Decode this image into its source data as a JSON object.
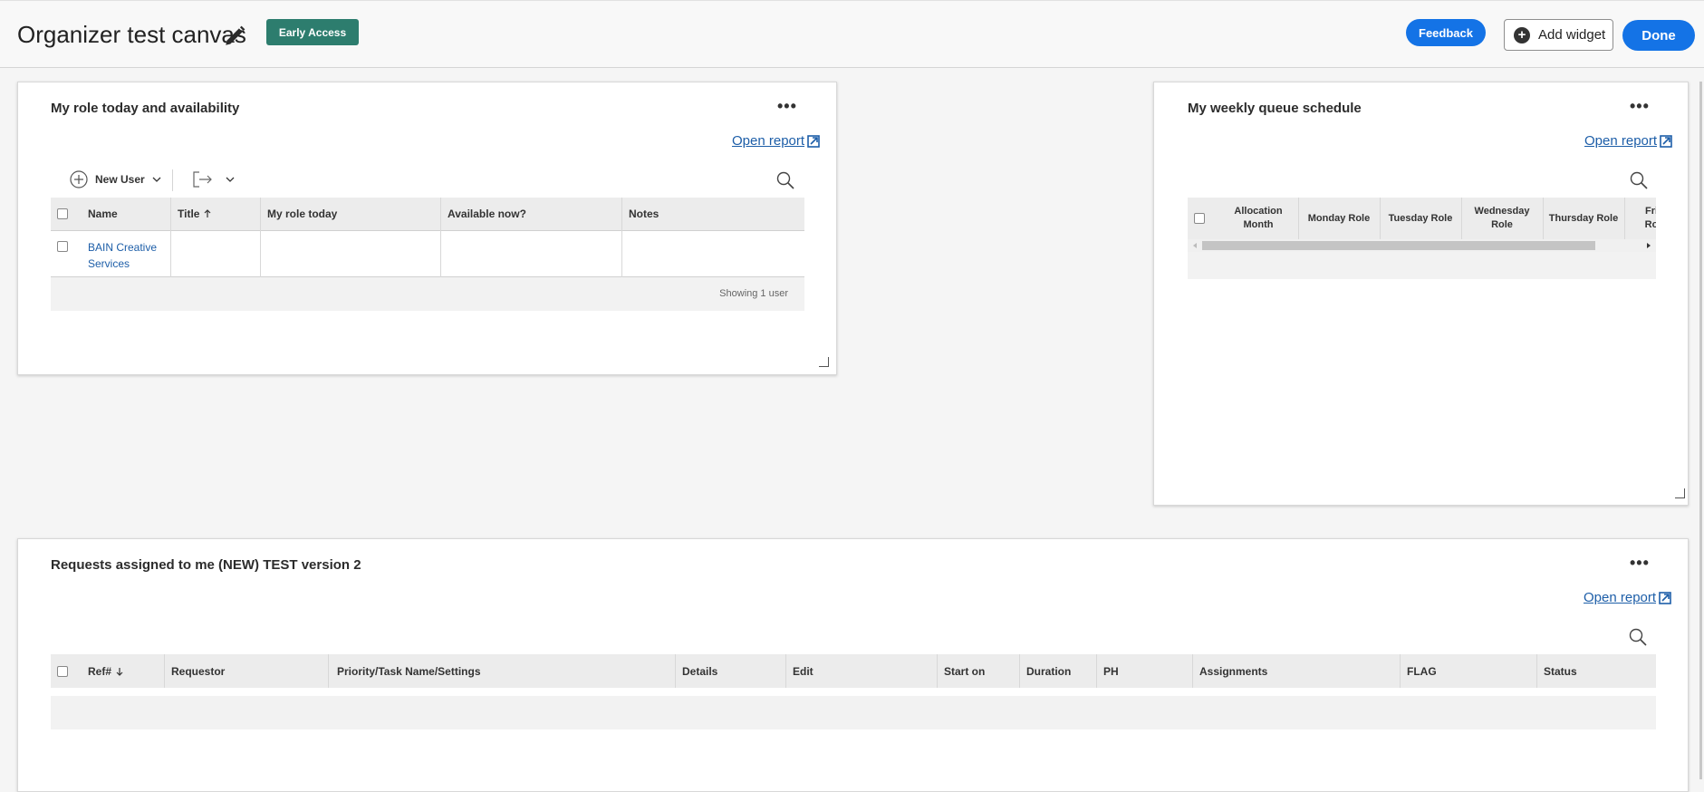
{
  "header": {
    "title": "Organizer test canvas",
    "badge": "Early Access",
    "feedback_label": "Feedback",
    "add_widget_label": "Add widget",
    "done_label": "Done"
  },
  "widget_role": {
    "title": "My role today and availability",
    "open_report": "Open report",
    "new_user_label": "New User",
    "columns": [
      "Name",
      "Title",
      "My role today",
      "Available now?",
      "Notes"
    ],
    "rows": [
      {
        "name_line1": "BAIN Creative",
        "name_line2": "Services",
        "title": "",
        "role": "",
        "available": "",
        "notes": ""
      }
    ],
    "footer": "Showing 1 user"
  },
  "widget_queue": {
    "title": "My weekly queue schedule",
    "open_report": "Open report",
    "columns": [
      {
        "l1": "Allocation",
        "l2": "Month"
      },
      {
        "l1": "Monday Role",
        "l2": ""
      },
      {
        "l1": "Tuesday Role",
        "l2": ""
      },
      {
        "l1": "Wednesday",
        "l2": "Role"
      },
      {
        "l1": "Thursday Role",
        "l2": ""
      },
      {
        "l1": "Fri",
        "l2": "Ro"
      }
    ]
  },
  "widget_requests": {
    "title": "Requests assigned to me (NEW) TEST version 2",
    "open_report": "Open report",
    "columns": [
      "Ref#",
      "Requestor",
      "Priority/Task Name/Settings",
      "Details",
      "Edit",
      "Start on",
      "Duration",
      "PH",
      "Assignments",
      "FLAG",
      "Status"
    ]
  },
  "icons": {
    "edit": "pencil-icon",
    "more": "more-horizontal-icon",
    "external": "external-link-icon",
    "search": "search-icon",
    "add": "plus-circle-icon",
    "export": "export-icon",
    "chevron": "chevron-down-icon"
  },
  "colors": {
    "primary_blue": "#1473e6",
    "badge_green": "#2d7d6e",
    "link_blue": "#1d5ea8"
  }
}
